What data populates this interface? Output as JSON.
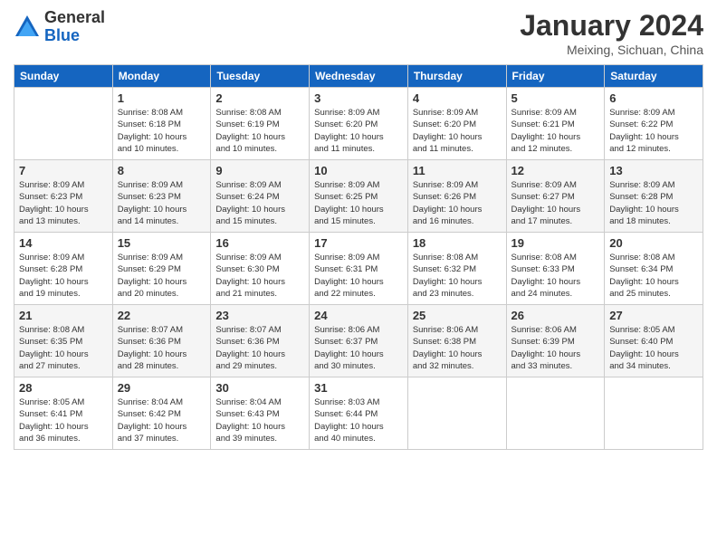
{
  "header": {
    "logo_general": "General",
    "logo_blue": "Blue",
    "month_title": "January 2024",
    "location": "Meixing, Sichuan, China"
  },
  "days_of_week": [
    "Sunday",
    "Monday",
    "Tuesday",
    "Wednesday",
    "Thursday",
    "Friday",
    "Saturday"
  ],
  "weeks": [
    [
      {
        "day": "",
        "info": ""
      },
      {
        "day": "1",
        "info": "Sunrise: 8:08 AM\nSunset: 6:18 PM\nDaylight: 10 hours\nand 10 minutes."
      },
      {
        "day": "2",
        "info": "Sunrise: 8:08 AM\nSunset: 6:19 PM\nDaylight: 10 hours\nand 10 minutes."
      },
      {
        "day": "3",
        "info": "Sunrise: 8:09 AM\nSunset: 6:20 PM\nDaylight: 10 hours\nand 11 minutes."
      },
      {
        "day": "4",
        "info": "Sunrise: 8:09 AM\nSunset: 6:20 PM\nDaylight: 10 hours\nand 11 minutes."
      },
      {
        "day": "5",
        "info": "Sunrise: 8:09 AM\nSunset: 6:21 PM\nDaylight: 10 hours\nand 12 minutes."
      },
      {
        "day": "6",
        "info": "Sunrise: 8:09 AM\nSunset: 6:22 PM\nDaylight: 10 hours\nand 12 minutes."
      }
    ],
    [
      {
        "day": "7",
        "info": "Sunrise: 8:09 AM\nSunset: 6:23 PM\nDaylight: 10 hours\nand 13 minutes."
      },
      {
        "day": "8",
        "info": "Sunrise: 8:09 AM\nSunset: 6:23 PM\nDaylight: 10 hours\nand 14 minutes."
      },
      {
        "day": "9",
        "info": "Sunrise: 8:09 AM\nSunset: 6:24 PM\nDaylight: 10 hours\nand 15 minutes."
      },
      {
        "day": "10",
        "info": "Sunrise: 8:09 AM\nSunset: 6:25 PM\nDaylight: 10 hours\nand 15 minutes."
      },
      {
        "day": "11",
        "info": "Sunrise: 8:09 AM\nSunset: 6:26 PM\nDaylight: 10 hours\nand 16 minutes."
      },
      {
        "day": "12",
        "info": "Sunrise: 8:09 AM\nSunset: 6:27 PM\nDaylight: 10 hours\nand 17 minutes."
      },
      {
        "day": "13",
        "info": "Sunrise: 8:09 AM\nSunset: 6:28 PM\nDaylight: 10 hours\nand 18 minutes."
      }
    ],
    [
      {
        "day": "14",
        "info": "Sunrise: 8:09 AM\nSunset: 6:28 PM\nDaylight: 10 hours\nand 19 minutes."
      },
      {
        "day": "15",
        "info": "Sunrise: 8:09 AM\nSunset: 6:29 PM\nDaylight: 10 hours\nand 20 minutes."
      },
      {
        "day": "16",
        "info": "Sunrise: 8:09 AM\nSunset: 6:30 PM\nDaylight: 10 hours\nand 21 minutes."
      },
      {
        "day": "17",
        "info": "Sunrise: 8:09 AM\nSunset: 6:31 PM\nDaylight: 10 hours\nand 22 minutes."
      },
      {
        "day": "18",
        "info": "Sunrise: 8:08 AM\nSunset: 6:32 PM\nDaylight: 10 hours\nand 23 minutes."
      },
      {
        "day": "19",
        "info": "Sunrise: 8:08 AM\nSunset: 6:33 PM\nDaylight: 10 hours\nand 24 minutes."
      },
      {
        "day": "20",
        "info": "Sunrise: 8:08 AM\nSunset: 6:34 PM\nDaylight: 10 hours\nand 25 minutes."
      }
    ],
    [
      {
        "day": "21",
        "info": "Sunrise: 8:08 AM\nSunset: 6:35 PM\nDaylight: 10 hours\nand 27 minutes."
      },
      {
        "day": "22",
        "info": "Sunrise: 8:07 AM\nSunset: 6:36 PM\nDaylight: 10 hours\nand 28 minutes."
      },
      {
        "day": "23",
        "info": "Sunrise: 8:07 AM\nSunset: 6:36 PM\nDaylight: 10 hours\nand 29 minutes."
      },
      {
        "day": "24",
        "info": "Sunrise: 8:06 AM\nSunset: 6:37 PM\nDaylight: 10 hours\nand 30 minutes."
      },
      {
        "day": "25",
        "info": "Sunrise: 8:06 AM\nSunset: 6:38 PM\nDaylight: 10 hours\nand 32 minutes."
      },
      {
        "day": "26",
        "info": "Sunrise: 8:06 AM\nSunset: 6:39 PM\nDaylight: 10 hours\nand 33 minutes."
      },
      {
        "day": "27",
        "info": "Sunrise: 8:05 AM\nSunset: 6:40 PM\nDaylight: 10 hours\nand 34 minutes."
      }
    ],
    [
      {
        "day": "28",
        "info": "Sunrise: 8:05 AM\nSunset: 6:41 PM\nDaylight: 10 hours\nand 36 minutes."
      },
      {
        "day": "29",
        "info": "Sunrise: 8:04 AM\nSunset: 6:42 PM\nDaylight: 10 hours\nand 37 minutes."
      },
      {
        "day": "30",
        "info": "Sunrise: 8:04 AM\nSunset: 6:43 PM\nDaylight: 10 hours\nand 39 minutes."
      },
      {
        "day": "31",
        "info": "Sunrise: 8:03 AM\nSunset: 6:44 PM\nDaylight: 10 hours\nand 40 minutes."
      },
      {
        "day": "",
        "info": ""
      },
      {
        "day": "",
        "info": ""
      },
      {
        "day": "",
        "info": ""
      }
    ]
  ]
}
